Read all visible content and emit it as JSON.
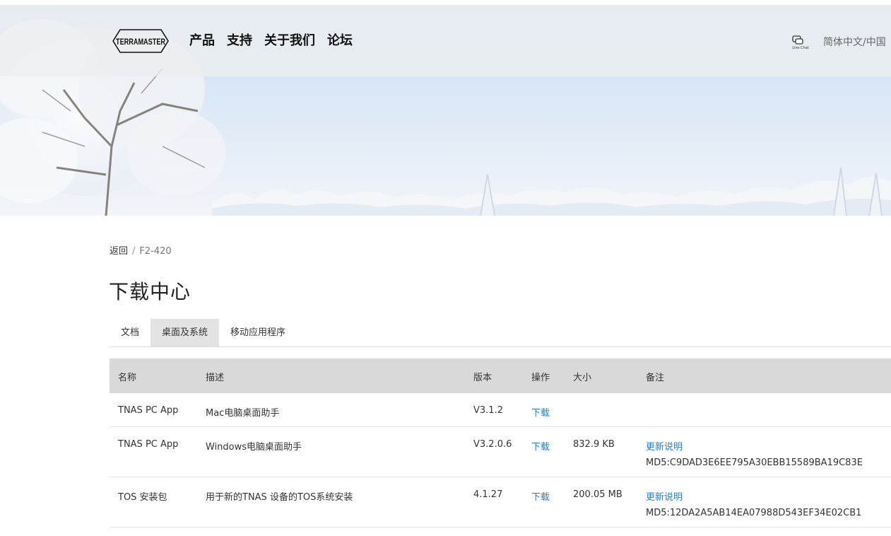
{
  "header": {
    "logo_text": "TERRAMASTER",
    "nav": [
      "产品",
      "支持",
      "关于我们",
      "论坛"
    ],
    "chat_icon": "live-chat-icon",
    "chat_text": "Live Chat",
    "language": "简体中文/中国"
  },
  "breadcrumb": {
    "back": "返回",
    "separator": "/",
    "current": "F2-420"
  },
  "page_title": "下载中心",
  "tabs": [
    {
      "label": "文档",
      "active": false
    },
    {
      "label": "桌面及系统",
      "active": true
    },
    {
      "label": "移动应用程序",
      "active": false
    }
  ],
  "table": {
    "headers": {
      "name": "名称",
      "desc": "描述",
      "version": "版本",
      "op": "操作",
      "size": "大小",
      "note": "备注"
    },
    "rows": [
      {
        "name": "TNAS PC App",
        "desc": "Mac电脑桌面助手",
        "version": "V3.1.2",
        "op": "下载",
        "size": "",
        "note": "",
        "md5": ""
      },
      {
        "name": "TNAS PC App",
        "desc": "Windows电脑桌面助手",
        "version": "V3.2.0.6",
        "op": "下载",
        "size": "832.9 KB",
        "note": "更新说明",
        "md5": "MD5:C9DAD3E6EE795A30EBB15589BA19C83E"
      },
      {
        "name": "TOS 安装包",
        "desc": "用于新的TNAS 设备的TOS系统安装",
        "version": "4.1.27",
        "op": "下载",
        "size": "200.05 MB",
        "note": "更新说明",
        "md5": "MD5:12DA2A5AB14EA07988D543EF34E02CB1"
      }
    ]
  },
  "colors": {
    "link": "#2a7dc4",
    "table_header_bg": "#d9d9d9",
    "active_tab_bg": "#e3e3e3"
  }
}
